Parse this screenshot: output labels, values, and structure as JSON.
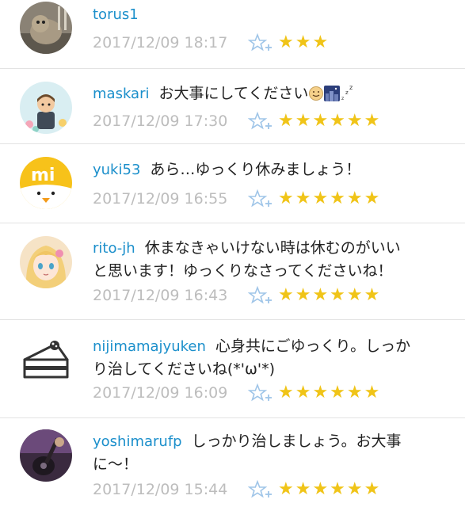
{
  "comments": [
    {
      "username": "torus1",
      "text": "",
      "text2": "",
      "timestamp": "2017/12/09 18:17",
      "stars": "★★★",
      "rating": 3,
      "avatar": "photo-avatar"
    },
    {
      "username": "maskari",
      "text": "お大事にしてください",
      "text2": "",
      "timestamp": "2017/12/09 17:30",
      "stars": "★★★★★★",
      "rating": 6,
      "avatar": "illustrated-avatar"
    },
    {
      "username": "yuki53",
      "text": "あら…ゆっくり休みましょう！",
      "text2": "",
      "timestamp": "2017/12/09 16:55",
      "stars": "★★★★★★",
      "rating": 6,
      "avatar": "mi-logo-avatar"
    },
    {
      "username": "rito-jh",
      "text": "休まなきゃいけない時は休むのがいい",
      "text2": "と思います！ゆっくりなさってくださいね！",
      "timestamp": "2017/12/09 16:43",
      "stars": "★★★★★★",
      "rating": 6,
      "avatar": "anime-avatar"
    },
    {
      "username": "nijimamajyuken",
      "text": "心身共にごゆっくり。しっか",
      "text2": "り治してくださいね(*'ω'*)",
      "timestamp": "2017/12/09 16:09",
      "stars": "★★★★★★",
      "rating": 6,
      "avatar": "cake-avatar"
    },
    {
      "username": "yoshimarufp",
      "text": "しっかり治しましょう。お大事",
      "text2": "に〜！",
      "timestamp": "2017/12/09 15:44",
      "stars": "★★★★★★",
      "rating": 6,
      "avatar": "guitar-photo-avatar"
    }
  ],
  "colors": {
    "username": "#1b8fcb",
    "timestamp": "#bdbdbd",
    "star": "#f0c418",
    "fav_icon": "#9fc5e8"
  }
}
